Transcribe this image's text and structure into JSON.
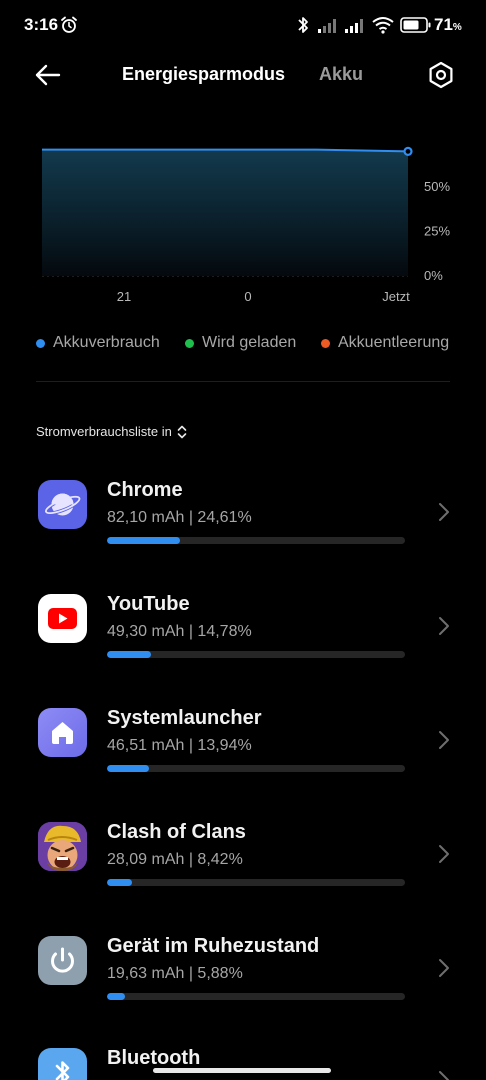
{
  "status_bar": {
    "time": "3:16",
    "battery": "71",
    "battery_unit": "%"
  },
  "app_bar": {
    "tab_active": "Energiesparmodus",
    "tab_inactive": "Akku"
  },
  "chart_data": {
    "type": "area",
    "x_tick_labels": [
      "21",
      "0",
      "Jetzt"
    ],
    "y_tick_labels": [
      "50%",
      "25%",
      "0%"
    ],
    "series": [
      {
        "name": "Akkuverbrauch",
        "x": [
          0,
          0.75,
          1.0
        ],
        "y": [
          71,
          71,
          70
        ]
      }
    ],
    "ylim": [
      0,
      100
    ],
    "grid": true,
    "colors": {
      "line": "#2f8ef0"
    }
  },
  "legend": [
    {
      "label": "Akkuverbrauch",
      "color": "#2f8ef0"
    },
    {
      "label": "Wird geladen",
      "color": "#1fbf4e"
    },
    {
      "label": "Akkuentleerung",
      "color": "#ee5a24"
    }
  ],
  "list": {
    "sort_label": "Stromverbrauchsliste in",
    "apps": [
      {
        "name": "Chrome",
        "usage": "82,10 mAh | 24,61%",
        "share": 0.2461,
        "icon": "chrome-planet-icon"
      },
      {
        "name": "YouTube",
        "usage": "49,30 mAh | 14,78%",
        "share": 0.1478,
        "icon": "youtube-icon"
      },
      {
        "name": "Systemlauncher",
        "usage": "46,51 mAh | 13,94%",
        "share": 0.1394,
        "icon": "home-icon"
      },
      {
        "name": "Clash of Clans",
        "usage": "28,09 mAh | 8,42%",
        "share": 0.0842,
        "icon": "clash-of-clans-icon"
      },
      {
        "name": "Gerät im Ruhezustand",
        "usage": "19,63 mAh | 5,88%",
        "share": 0.0588,
        "icon": "power-icon"
      },
      {
        "name": "Bluetooth",
        "icon": "bluetooth-icon"
      }
    ]
  },
  "colors": {
    "accent": "#2f8ef0",
    "background": "#000000"
  }
}
